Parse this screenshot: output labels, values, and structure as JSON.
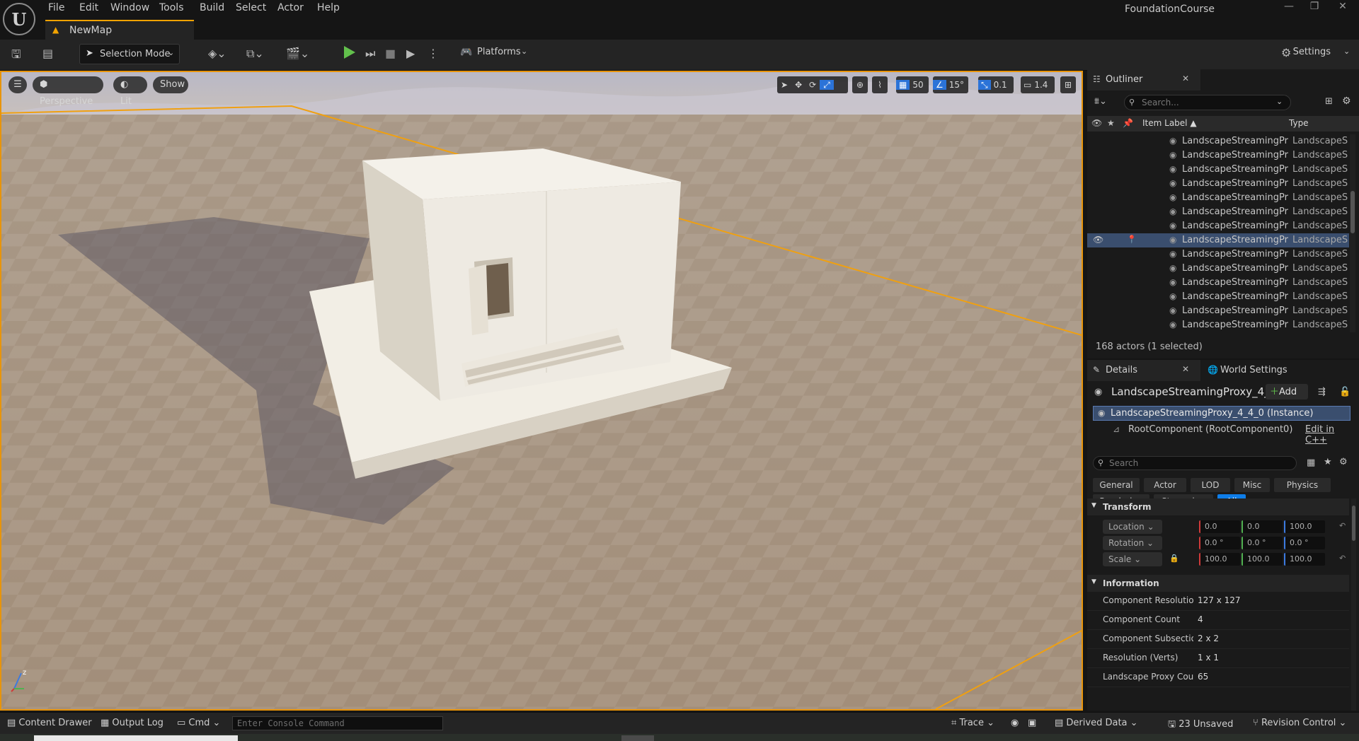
{
  "menu": {
    "items": [
      "File",
      "Edit",
      "Window",
      "Tools",
      "Build",
      "Select",
      "Actor",
      "Help"
    ],
    "project_name": "FoundationCourse"
  },
  "map_tab": {
    "label": "NewMap"
  },
  "toolbar": {
    "selection_mode": "Selection Mode",
    "platforms": "Platforms",
    "settings": "Settings"
  },
  "viewport": {
    "perspective": "Perspective",
    "lit": "Lit",
    "show": "Show",
    "grid_snap": "50",
    "rotation_snap": "15°",
    "scale_snap": "0.1",
    "camera_speed": "1.4",
    "axis_z": "z"
  },
  "outliner": {
    "tab_label": "Outliner",
    "search_placeholder": "Search...",
    "col_item_label": "Item Label ▲",
    "col_type": "Type",
    "row_label": "LandscapeStreamingPro:",
    "row_type": "LandscapeSt",
    "rows": [
      {
        "label": "LandscapeStreamingPro:",
        "type": "LandscapeSt",
        "selected": false
      },
      {
        "label": "LandscapeStreamingPro:",
        "type": "LandscapeSt",
        "selected": false
      },
      {
        "label": "LandscapeStreamingPro:",
        "type": "LandscapeSt",
        "selected": false
      },
      {
        "label": "LandscapeStreamingPro:",
        "type": "LandscapeSt",
        "selected": false
      },
      {
        "label": "LandscapeStreamingPro:",
        "type": "LandscapeSt",
        "selected": false
      },
      {
        "label": "LandscapeStreamingPro:",
        "type": "LandscapeSt",
        "selected": false
      },
      {
        "label": "LandscapeStreamingPro:",
        "type": "LandscapeSt",
        "selected": false
      },
      {
        "label": "LandscapeStreamingPro:",
        "type": "LandscapeSt",
        "selected": true
      },
      {
        "label": "LandscapeStreamingPro:",
        "type": "LandscapeSt",
        "selected": false
      },
      {
        "label": "LandscapeStreamingPro:",
        "type": "LandscapeSt",
        "selected": false
      },
      {
        "label": "LandscapeStreamingPro:",
        "type": "LandscapeSt",
        "selected": false
      },
      {
        "label": "LandscapeStreamingPro:",
        "type": "LandscapeSt",
        "selected": false
      },
      {
        "label": "LandscapeStreamingPro:",
        "type": "LandscapeSt",
        "selected": false
      },
      {
        "label": "LandscapeStreamingPro:",
        "type": "LandscapeSt",
        "selected": false
      }
    ],
    "status": "168 actors (1 selected)"
  },
  "details": {
    "tab_label": "Details",
    "world_settings_tab": "World Settings",
    "actor_name": "LandscapeStreamingProxy_4_",
    "add_label": "Add",
    "instance_row": "LandscapeStreamingProxy_4_4_0 (Instance)",
    "root_component": "RootComponent (RootComponent0)",
    "edit_cpp": "Edit in C++",
    "search_placeholder": "Search",
    "filters_row1": [
      "General",
      "Actor",
      "LOD",
      "Misc",
      "Physics"
    ],
    "filters_row2": [
      "Rendering",
      "Streaming",
      "All"
    ],
    "transform": {
      "header": "Transform",
      "location_label": "Location",
      "rotation_label": "Rotation",
      "scale_label": "Scale",
      "location": [
        "0.0",
        "0.0",
        "100.0"
      ],
      "rotation": [
        "0.0 °",
        "0.0 °",
        "0.0 °"
      ],
      "scale": [
        "100.0",
        "100.0",
        "100.0"
      ]
    },
    "information": {
      "header": "Information",
      "rows": [
        {
          "label": "Component Resolution (\\",
          "value": "127 x 127"
        },
        {
          "label": "Component Count",
          "value": "4"
        },
        {
          "label": "Component Subsections",
          "value": "2 x 2"
        },
        {
          "label": "Resolution (Verts)",
          "value": "1 x 1"
        },
        {
          "label": "Landscape Proxy Count",
          "value": "65"
        }
      ]
    }
  },
  "bottombar": {
    "content_drawer": "Content Drawer",
    "output_log": "Output Log",
    "cmd": "Cmd",
    "console_placeholder": "Enter Console Command",
    "trace": "Trace",
    "derived_data": "Derived Data",
    "unsaved": "23 Unsaved",
    "revision_control": "Revision Control"
  },
  "colors": {
    "accent_blue": "#0e7de8",
    "selection_orange": "#e8940a",
    "play_green": "#62c04c"
  }
}
